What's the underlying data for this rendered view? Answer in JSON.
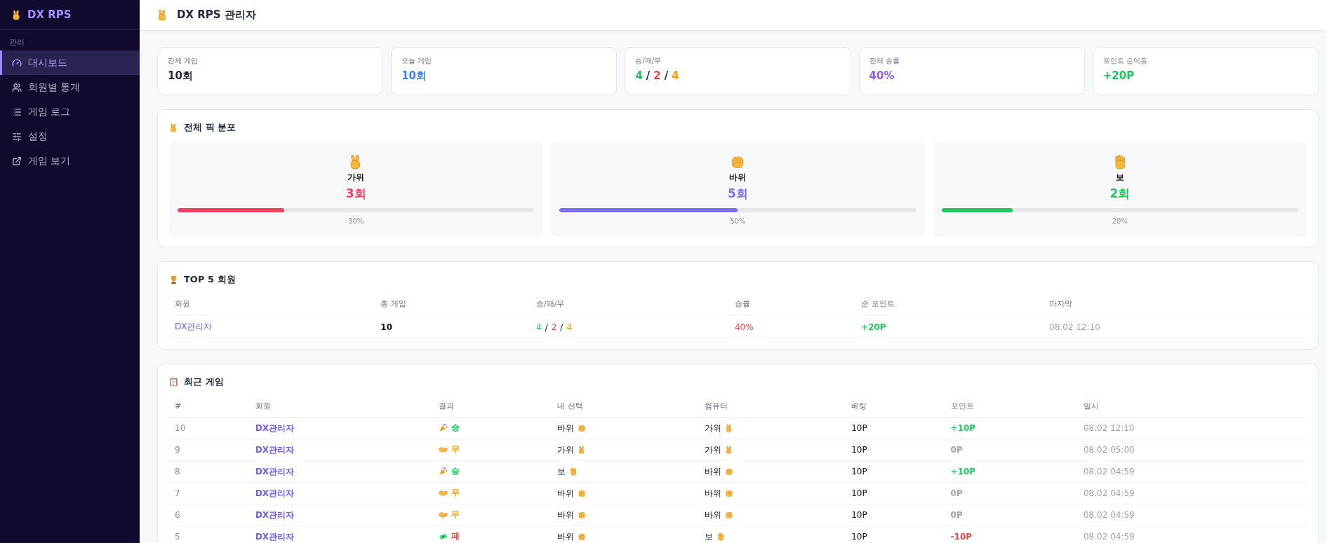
{
  "sidebar": {
    "brand": "DX RPS",
    "section": "관리",
    "items": [
      {
        "label": "대시보드",
        "kind": "gauge",
        "selected": true
      },
      {
        "label": "회원별 통계",
        "kind": "users",
        "selected": false
      },
      {
        "label": "게임 로그",
        "kind": "list",
        "selected": false
      },
      {
        "label": "설정",
        "kind": "sliders",
        "selected": false
      },
      {
        "label": "게임 보기",
        "kind": "external",
        "selected": false
      }
    ]
  },
  "header": {
    "title": "DX RPS 관리자"
  },
  "stats": [
    {
      "label": "전체 게임",
      "parts": [
        {
          "text": "10회",
          "color": "#1f2937"
        }
      ]
    },
    {
      "label": "오늘 게임",
      "parts": [
        {
          "text": "10회",
          "color": "#3b82f6"
        }
      ]
    },
    {
      "label": "승/패/무",
      "parts": [
        {
          "text": "4",
          "color": "#22c55e"
        },
        {
          "text": "/",
          "color": "#1f2937"
        },
        {
          "text": "2",
          "color": "#ef4444"
        },
        {
          "text": "/",
          "color": "#1f2937"
        },
        {
          "text": "4",
          "color": "#f59e0b"
        }
      ]
    },
    {
      "label": "전체 승률",
      "parts": [
        {
          "text": "40%",
          "color": "#8b5cf6"
        }
      ]
    },
    {
      "label": "포인트 순이동",
      "parts": [
        {
          "text": "+20P",
          "color": "#22c55e"
        }
      ]
    }
  ],
  "distribution": {
    "title": "전체 픽 분포",
    "picks": [
      {
        "kind": "scissors",
        "label": "가위",
        "count": "3회",
        "percent": "30%",
        "level": 0.3,
        "color": "#f43f5e"
      },
      {
        "kind": "rock",
        "label": "바위",
        "count": "5회",
        "percent": "50%",
        "level": 0.5,
        "color": "#7c6ff5"
      },
      {
        "kind": "paper",
        "label": "보",
        "count": "2회",
        "percent": "20%",
        "level": 0.2,
        "color": "#22c55e"
      }
    ]
  },
  "top_members": {
    "title": "TOP 5 회원",
    "columns": [
      "회원",
      "총 게임",
      "승/패/무",
      "승률",
      "순 포인트",
      "마지막"
    ],
    "rows": [
      {
        "member": "DX관리자",
        "games": "10",
        "wins": "4",
        "losses": "2",
        "draws": "4",
        "separator": "/",
        "rate": "40%",
        "points": "+20P",
        "last": "08.02 12:10"
      }
    ]
  },
  "recent_games": {
    "title": "최근 게임",
    "columns": [
      "#",
      "회원",
      "결과",
      "내 선택",
      "컴퓨터",
      "베팅",
      "포인트",
      "일시"
    ],
    "rows": [
      {
        "no": "10",
        "member": "DX관리자",
        "result": {
          "kind": "win",
          "label": "승"
        },
        "mine": {
          "kind": "rock",
          "label": "바위"
        },
        "cpu": {
          "kind": "scissors",
          "label": "가위"
        },
        "bet": "10P",
        "points": {
          "kind": "plus",
          "text": "+10P"
        },
        "time": "08.02 12:10"
      },
      {
        "no": "9",
        "member": "DX관리자",
        "result": {
          "kind": "draw",
          "label": "무"
        },
        "mine": {
          "kind": "scissors",
          "label": "가위"
        },
        "cpu": {
          "kind": "scissors",
          "label": "가위"
        },
        "bet": "10P",
        "points": {
          "kind": "zero",
          "text": "0P"
        },
        "time": "08.02 05:00"
      },
      {
        "no": "8",
        "member": "DX관리자",
        "result": {
          "kind": "win",
          "label": "승"
        },
        "mine": {
          "kind": "paper",
          "label": "보"
        },
        "cpu": {
          "kind": "rock",
          "label": "바위"
        },
        "bet": "10P",
        "points": {
          "kind": "plus",
          "text": "+10P"
        },
        "time": "08.02 04:59"
      },
      {
        "no": "7",
        "member": "DX관리자",
        "result": {
          "kind": "draw",
          "label": "무"
        },
        "mine": {
          "kind": "rock",
          "label": "바위"
        },
        "cpu": {
          "kind": "rock",
          "label": "바위"
        },
        "bet": "10P",
        "points": {
          "kind": "zero",
          "text": "0P"
        },
        "time": "08.02 04:59"
      },
      {
        "no": "6",
        "member": "DX관리자",
        "result": {
          "kind": "draw",
          "label": "무"
        },
        "mine": {
          "kind": "rock",
          "label": "바위"
        },
        "cpu": {
          "kind": "rock",
          "label": "바위"
        },
        "bet": "10P",
        "points": {
          "kind": "zero",
          "text": "0P"
        },
        "time": "08.02 04:59"
      },
      {
        "no": "5",
        "member": "DX관리자",
        "result": {
          "kind": "lose",
          "label": "패"
        },
        "mine": {
          "kind": "rock",
          "label": "바위"
        },
        "cpu": {
          "kind": "paper",
          "label": "보"
        },
        "bet": "10P",
        "points": {
          "kind": "minus",
          "text": "-10P"
        },
        "time": "08.02 04:59"
      }
    ]
  }
}
